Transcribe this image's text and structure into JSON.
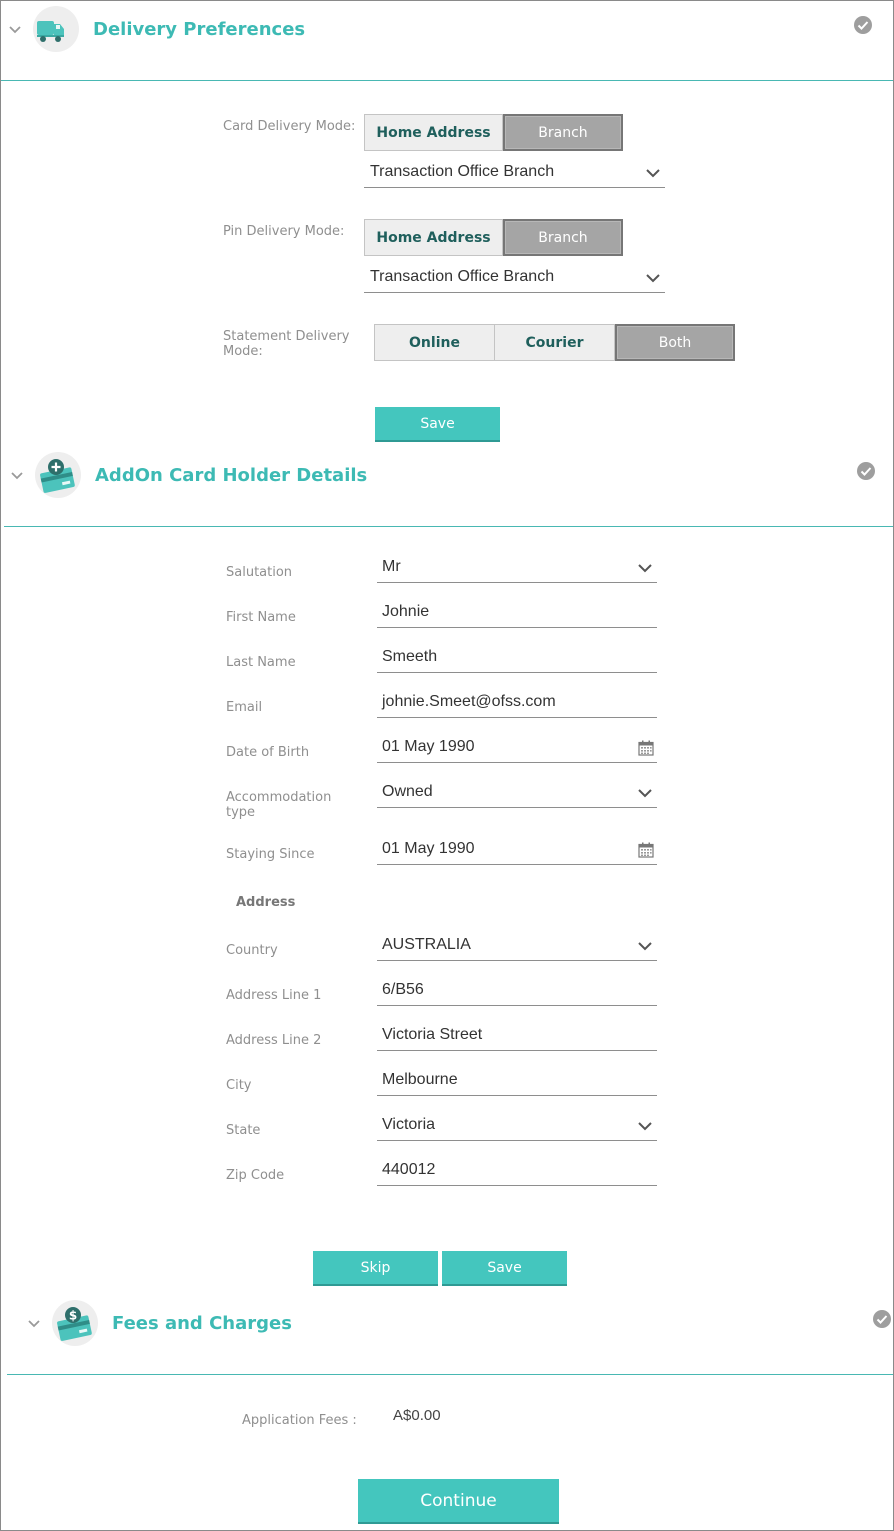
{
  "delivery": {
    "title": "Delivery Preferences",
    "icon": "truck-icon",
    "card_delivery_label": "Card Delivery Mode:",
    "card_delivery_options": [
      "Home Address",
      "Branch"
    ],
    "card_delivery_selected": "Branch",
    "card_branch_value": "Transaction Office Branch",
    "pin_delivery_label": "Pin Delivery Mode:",
    "pin_delivery_options": [
      "Home Address",
      "Branch"
    ],
    "pin_delivery_selected": "Branch",
    "pin_branch_value": "Transaction Office Branch",
    "statement_label": "Statement Delivery Mode:",
    "statement_options": [
      "Online",
      "Courier",
      "Both"
    ],
    "statement_selected": "Both",
    "save_label": "Save"
  },
  "addon": {
    "title": "AddOn Card Holder Details",
    "icon": "add-card-icon",
    "salutation_label": "Salutation",
    "salutation_value": "Mr",
    "first_name_label": "First Name",
    "first_name_value": "Johnie",
    "last_name_label": "Last Name",
    "last_name_value": "Smeeth",
    "email_label": "Email",
    "email_value": "johnie.Smeet@ofss.com",
    "dob_label": "Date of Birth",
    "dob_value": "01 May 1990",
    "accommodation_label": "Accommodation type",
    "accommodation_value": "Owned",
    "staying_since_label": "Staying Since",
    "staying_since_value": "01 May 1990",
    "address_heading": "Address",
    "country_label": "Country",
    "country_value": "AUSTRALIA",
    "address1_label": "Address Line 1",
    "address1_value": "6/B56",
    "address2_label": "Address Line 2",
    "address2_value": "Victoria Street",
    "city_label": "City",
    "city_value": "Melbourne",
    "state_label": "State",
    "state_value": "Victoria",
    "zip_label": "Zip Code",
    "zip_value": "440012",
    "skip_label": "Skip",
    "save_label": "Save"
  },
  "fees": {
    "title": "Fees and Charges",
    "icon": "card-dollar-icon",
    "application_fees_label": "Application Fees :",
    "application_fees_value": "A$0.00",
    "continue_label": "Continue"
  },
  "colors": {
    "accent": "#44c6be",
    "title": "#3dbab4",
    "selected_toggle": "#a5a5a5",
    "check": "#9e9e9e"
  }
}
